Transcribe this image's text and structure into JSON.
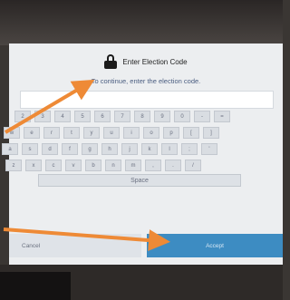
{
  "dialog": {
    "title": "Enter Election Code",
    "instruction": "To continue, enter the election code.",
    "icon": "lock-icon"
  },
  "keyboard": {
    "rows": [
      [
        "2",
        "3",
        "4",
        "5",
        "6",
        "7",
        "8",
        "9",
        "0",
        "-",
        "="
      ],
      [
        "w",
        "e",
        "r",
        "t",
        "y",
        "u",
        "i",
        "o",
        "p",
        "[",
        "]"
      ],
      [
        "a",
        "s",
        "d",
        "f",
        "g",
        "h",
        "j",
        "k",
        "l",
        ";",
        "'"
      ],
      [
        "z",
        "x",
        "c",
        "v",
        "b",
        "n",
        "m",
        ",",
        ".",
        "/"
      ]
    ],
    "space_label": "Space"
  },
  "buttons": {
    "cancel_label": "Cancel",
    "accept_label": "Accept"
  },
  "colors": {
    "accent": "#3d8cc2",
    "annotation_arrow": "#ee8a36"
  }
}
